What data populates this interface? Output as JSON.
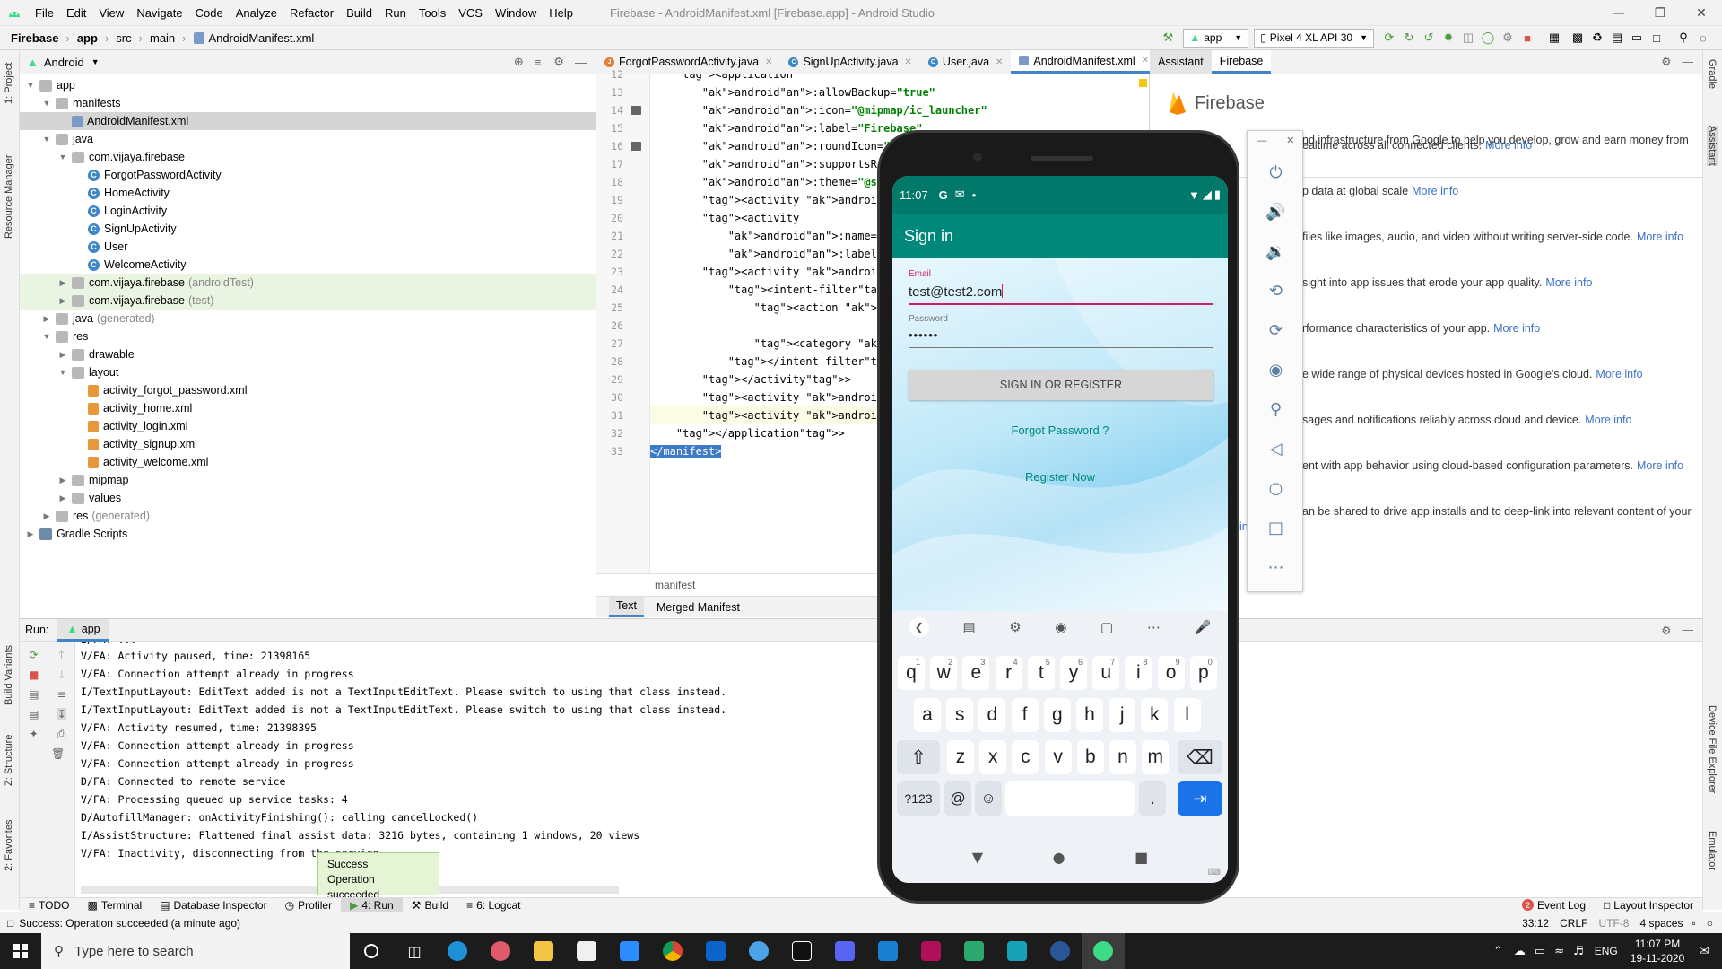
{
  "window": {
    "title": "Firebase - AndroidManifest.xml [Firebase.app] - Android Studio",
    "menus": [
      "File",
      "Edit",
      "View",
      "Navigate",
      "Code",
      "Analyze",
      "Refactor",
      "Build",
      "Run",
      "Tools",
      "VCS",
      "Window",
      "Help"
    ]
  },
  "breadcrumb": [
    "Firebase",
    "app",
    "src",
    "main",
    "AndroidManifest.xml"
  ],
  "toolbar": {
    "run_config": "app",
    "device": "Pixel 4 XL API 30"
  },
  "left_strip": [
    "1: Project",
    "Resource Manager",
    "Build Variants",
    "Z: Structure",
    "2: Favorites"
  ],
  "right_strip": [
    "Gradle",
    "Assistant",
    "Device File Explorer",
    "Emulator"
  ],
  "project": {
    "view_label": "Android",
    "tree": [
      {
        "label": "app",
        "kind": "folder",
        "depth": 0,
        "open": true
      },
      {
        "label": "manifests",
        "kind": "folder",
        "depth": 1,
        "open": true
      },
      {
        "label": "AndroidManifest.xml",
        "kind": "manifest",
        "depth": 2,
        "selected": true
      },
      {
        "label": "java",
        "kind": "folder",
        "depth": 1,
        "open": true
      },
      {
        "label": "com.vijaya.firebase",
        "kind": "folder",
        "depth": 2,
        "open": true
      },
      {
        "label": "ForgotPasswordActivity",
        "kind": "class",
        "depth": 3
      },
      {
        "label": "HomeActivity",
        "kind": "class",
        "depth": 3
      },
      {
        "label": "LoginActivity",
        "kind": "class",
        "depth": 3
      },
      {
        "label": "SignUpActivity",
        "kind": "class",
        "depth": 3
      },
      {
        "label": "User",
        "kind": "class",
        "depth": 3
      },
      {
        "label": "WelcomeActivity",
        "kind": "class",
        "depth": 3
      },
      {
        "label": "com.vijaya.firebase",
        "suffix": "(androidTest)",
        "kind": "folder",
        "depth": 2,
        "highlight": true
      },
      {
        "label": "com.vijaya.firebase",
        "suffix": "(test)",
        "kind": "folder",
        "depth": 2,
        "highlight": true
      },
      {
        "label": "java",
        "suffix": "(generated)",
        "kind": "folder",
        "depth": 1
      },
      {
        "label": "res",
        "kind": "folder",
        "depth": 1,
        "open": true
      },
      {
        "label": "drawable",
        "kind": "folder",
        "depth": 2
      },
      {
        "label": "layout",
        "kind": "folder",
        "depth": 2,
        "open": true
      },
      {
        "label": "activity_forgot_password.xml",
        "kind": "xml",
        "depth": 3
      },
      {
        "label": "activity_home.xml",
        "kind": "xml",
        "depth": 3
      },
      {
        "label": "activity_login.xml",
        "kind": "xml",
        "depth": 3
      },
      {
        "label": "activity_signup.xml",
        "kind": "xml",
        "depth": 3
      },
      {
        "label": "activity_welcome.xml",
        "kind": "xml",
        "depth": 3
      },
      {
        "label": "mipmap",
        "kind": "folder",
        "depth": 2
      },
      {
        "label": "values",
        "kind": "folder",
        "depth": 2
      },
      {
        "label": "res",
        "suffix": "(generated)",
        "kind": "folder",
        "depth": 1
      },
      {
        "label": "Gradle Scripts",
        "kind": "gradle",
        "depth": 0
      }
    ]
  },
  "editor": {
    "tabs": [
      "ForgotPasswordActivity.java",
      "SignUpActivity.java",
      "User.java",
      "AndroidManifest.xml"
    ],
    "active_tab": 3,
    "lines": [
      {
        "n": "12",
        "text": "    <application"
      },
      {
        "n": "13",
        "text": "        android:allowBackup=\"true\""
      },
      {
        "n": "14",
        "text": "        android:icon=\"@mipmap/ic_launcher\""
      },
      {
        "n": "15",
        "text": "        android:label=\"Firebase\""
      },
      {
        "n": "16",
        "text": "        android:roundIcon=\"@mipmap/ic"
      },
      {
        "n": "17",
        "text": "        android:supportsRtl=\"true\""
      },
      {
        "n": "18",
        "text": "        android:theme=\"@style/AppThe"
      },
      {
        "n": "19",
        "text": "        <activity android:name=\".Sig"
      },
      {
        "n": "20",
        "text": "        <activity"
      },
      {
        "n": "21",
        "text": "            android:name=\".LoginActi"
      },
      {
        "n": "22",
        "text": "            android:label=\"Sign in\""
      },
      {
        "n": "23",
        "text": "        <activity android:name=\".Wel"
      },
      {
        "n": "24",
        "text": "            <intent-filter>"
      },
      {
        "n": "25",
        "text": "                <action android:name"
      },
      {
        "n": "26",
        "text": ""
      },
      {
        "n": "27",
        "text": "                <category android:na"
      },
      {
        "n": "28",
        "text": "            </intent-filter>"
      },
      {
        "n": "29",
        "text": "        </activity>"
      },
      {
        "n": "30",
        "text": "        <activity android:name=\".Hom"
      },
      {
        "n": "31",
        "text": "        <activity android:name=\".For"
      },
      {
        "n": "32",
        "text": "    </application>"
      },
      {
        "n": "33",
        "text": "</manifest>"
      }
    ],
    "footer_breadcrumb": "manifest",
    "bottom_tabs": [
      "Text",
      "Merged Manifest"
    ]
  },
  "assistant": {
    "tabs": [
      "Assistant",
      "Firebase"
    ],
    "title": "Firebase",
    "intro": "nd infrastructure from Google to help you develop, grow and earn money from",
    "more_label": "More info",
    "items": [
      "ealtime across all connected clients.",
      "p data at global scale",
      "files like images, audio, and video without writing server-side code.",
      "sight into app issues that erode your app quality.",
      "ing",
      "rformance characteristics of your app.",
      "e wide range of physical devices hosted in Google's cloud.",
      "sages and notifications reliably across cloud and device.",
      "ent with app behavior using cloud-based configuration parameters.",
      "an be shared to drive app installs and to deep-link into relevant content of your",
      "info"
    ]
  },
  "run": {
    "label": "Run:",
    "config": "app",
    "log": [
      "V/FA: Activity paused, time: 21398165",
      "V/FA: Connection attempt already in progress",
      "I/TextInputLayout: EditText added is not a TextInputEditText. Please switch to using that class instead.",
      "I/TextInputLayout: EditText added is not a TextInputEditText. Please switch to using that class instead.",
      "V/FA: Activity resumed, time: 21398395",
      "V/FA: Connection attempt already in progress",
      "V/FA: Connection attempt already in progress",
      "D/FA: Connected to remote service",
      "V/FA: Processing queued up service tasks: 4",
      "D/AutofillManager: onActivityFinishing(): calling cancelLocked()",
      "I/AssistStructure: Flattened final assist data: 3216 bytes, containing 1 windows, 20 views",
      "V/FA: Inactivity, disconnecting from the service"
    ],
    "toast_title": "Success",
    "toast_body": "Operation succeeded"
  },
  "bottom_tools": [
    "TODO",
    "Terminal",
    "Database Inspector",
    "Profiler",
    "4: Run",
    "Build",
    "6: Logcat"
  ],
  "bottom_tools_right": [
    "Event Log",
    "Layout Inspector"
  ],
  "event_log_count": "2",
  "status": {
    "message": "Success: Operation succeeded (a minute ago)",
    "position": "33:12",
    "line_sep": "CRLF",
    "encoding": "UTF-8",
    "indent": "4 spaces"
  },
  "phone": {
    "time": "11:07",
    "app_title": "Sign in",
    "email_label": "Email",
    "email_value": "test@test2.com",
    "password_label": "Password",
    "password_value": "••••••",
    "signin_button": "SIGN IN OR REGISTER",
    "forgot_link": "Forgot Password ?",
    "register_link": "Register Now",
    "keyboard": {
      "row1": [
        "q",
        "w",
        "e",
        "r",
        "t",
        "y",
        "u",
        "i",
        "o",
        "p"
      ],
      "row1_sup": [
        "1",
        "2",
        "3",
        "4",
        "5",
        "6",
        "7",
        "8",
        "9",
        "0"
      ],
      "row2": [
        "a",
        "s",
        "d",
        "f",
        "g",
        "h",
        "j",
        "k",
        "l"
      ],
      "row3": [
        "z",
        "x",
        "c",
        "v",
        "b",
        "n",
        "m"
      ],
      "sym": "?123",
      "at": "@",
      "period": "."
    }
  },
  "taskbar": {
    "search_placeholder": "Type here to search",
    "lang": "ENG",
    "time": "11:07 PM",
    "date": "19-11-2020"
  },
  "colors": {
    "accent": "#4083c9",
    "teal": "#00897b",
    "pink": "#d81b60",
    "link": "#00897b"
  }
}
